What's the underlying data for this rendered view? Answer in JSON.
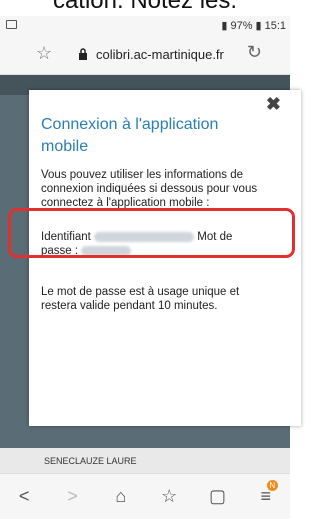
{
  "caption": "cation. Notez les.",
  "status": {
    "battery": "97%",
    "time": "15:1"
  },
  "browser": {
    "url": "colibri.ac-martinique.fr"
  },
  "modal": {
    "close": "✖",
    "title": "Connexion à l'application mobile",
    "body": "Vous pouvez utiliser les informations de connexion indiquées si dessous pour vous connectez à l'application mobile :",
    "id_label": "Identifiant",
    "password_label_a": "Mot de",
    "password_label_b": "passe :",
    "note": "Le mot de passe est à usage unique et restera valide pendant 10 minutes."
  },
  "page": {
    "student_name": "SENECLAUZE LAURE"
  },
  "nav": [
    "back",
    "forward",
    "home",
    "bookmarks",
    "tabs",
    "menu"
  ],
  "nav_badge": "N",
  "colors": {
    "title": "#2a7fb3",
    "highlight": "#e03030",
    "page_bg": "#5a6c76"
  }
}
